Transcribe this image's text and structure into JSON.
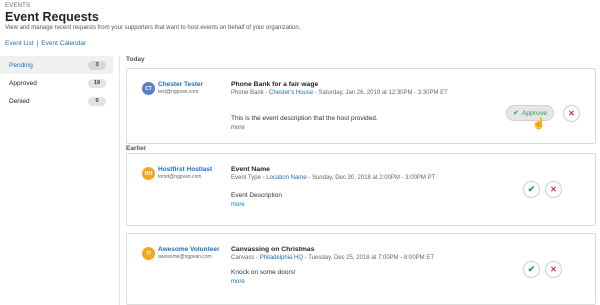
{
  "header": {
    "eyebrow": "EVENTS",
    "title": "Event Requests",
    "description": "View and manage recent requests from your supporters that want to host events on behalf of your organization."
  },
  "nav": {
    "event_list": "Event List",
    "separator": "|",
    "event_calendar": "Event Calendar"
  },
  "sidebar": {
    "items": [
      {
        "label": "Pending",
        "count": "3"
      },
      {
        "label": "Approved",
        "count": "19"
      },
      {
        "label": "Denied",
        "count": "0"
      }
    ]
  },
  "sections": {
    "today": "Today",
    "earlier": "Earlier"
  },
  "requests": [
    {
      "initials": "CT",
      "host_name": "Chester Tester",
      "host_email": "test@ngpvan.com",
      "event_name": "Phone Bank for a fair wage",
      "event_type": "Phone Bank",
      "dash": "-",
      "location": "Chester's House",
      "datetime": "- Saturday, Jan 26, 2019 at 12:30PM - 3:30PM ET",
      "description": "This is the event description that the host provided.",
      "more": "more",
      "approve_label": "Approve"
    },
    {
      "initials": "HH",
      "host_name": "Hostfirst Hostlast",
      "host_email": "tomd@ngpvan.com",
      "event_name": "Event Name",
      "event_type": "Event Type",
      "dash": "-",
      "location": "Location Name",
      "datetime": "- Sunday, Dec 30, 2018 at 2:00PM - 3:00PM PT",
      "description": "Event Description",
      "more": "more"
    },
    {
      "initials": "TI",
      "host_name": "Awesome Volunteer",
      "host_email": "awesome@ngpvan.com",
      "event_name": "Canvassing on Christmas",
      "event_type": "Canvass",
      "dash": "-",
      "location": "Philadelphia HQ",
      "datetime": "- Tuesday, Dec 25, 2018 at 7:00PM - 8:00PM ET",
      "description": "Knock on some doors!",
      "more": "more"
    }
  ],
  "icons": {
    "check": "check-icon",
    "close": "close-icon",
    "cursor": "hand-pointer-icon"
  },
  "colors": {
    "link": "#1f6fb6",
    "approve": "#2e9c4c",
    "deny": "#d23a3a",
    "avatar_blue": "#5a7fc7",
    "avatar_amber": "#f0a820"
  }
}
